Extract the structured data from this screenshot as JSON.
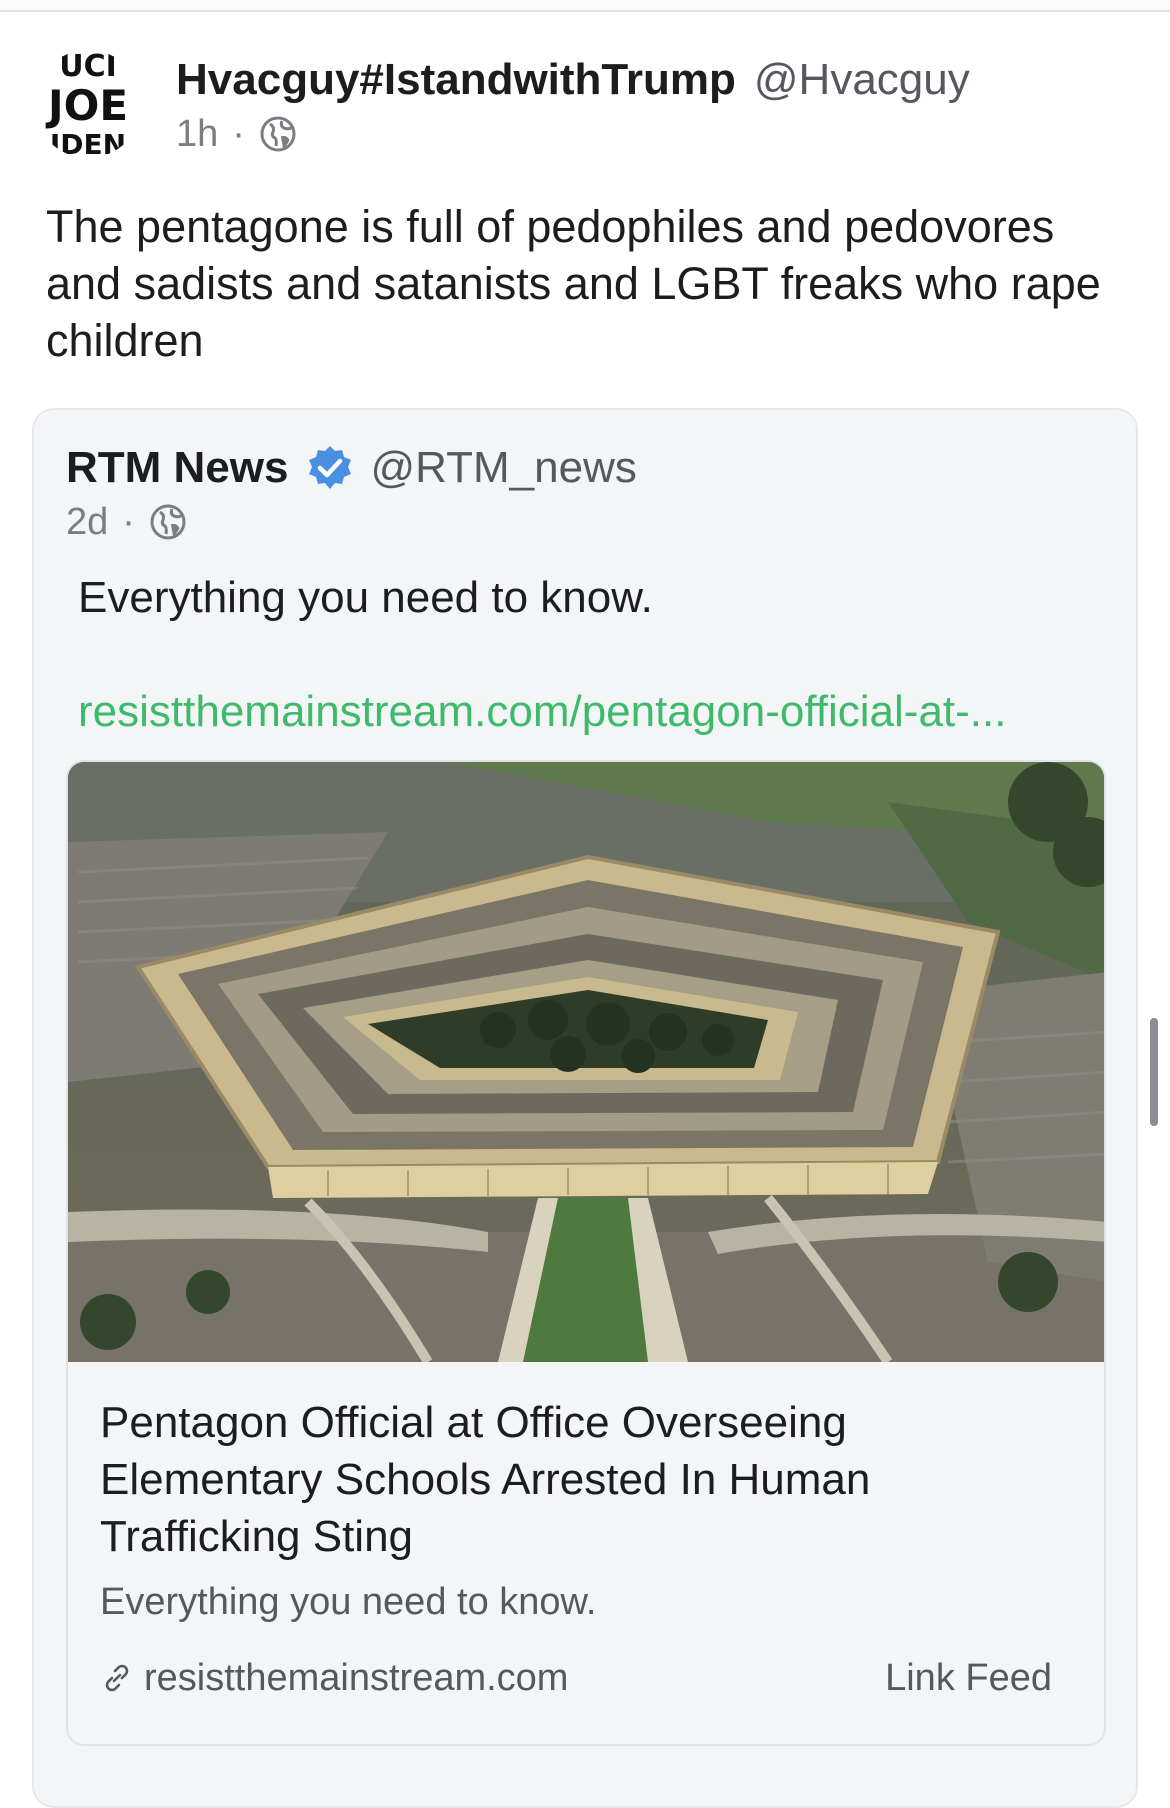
{
  "post": {
    "author_name": "Hvacguy#IstandwithTrump",
    "author_handle": "@Hvacguy",
    "time": "1h",
    "separator": "·",
    "visibility_icon": "globe-icon",
    "avatar_text": [
      "UCI",
      "JOE",
      "IDEN"
    ],
    "text": "The pentagone is full of pedophiles and pedovores and sadists and satanists and LGBT freaks who rape children"
  },
  "quoted_post": {
    "author_name": "RTM News",
    "verified_icon": "verified-badge-icon",
    "author_handle": "@RTM_news",
    "time": "2d",
    "separator": "·",
    "visibility_icon": "globe-icon",
    "text": "Everything you need to know.",
    "link_text": "resistthemainstream.com/pentagon-official-at-...",
    "link_card": {
      "image_icon": "pentagon-aerial-photo",
      "title": "Pentagon Official at Office Overseeing Elementary Schools Arrested In Human Trafficking Sting",
      "description": "Everything you need to know.",
      "domain": "resistthemainstream.com",
      "link_icon": "link-icon",
      "source_label": "Link Feed"
    }
  },
  "colors": {
    "link_green": "#3dba6a",
    "verified_blue": "#4a90e2",
    "quote_bg": "#f4f5f7"
  }
}
